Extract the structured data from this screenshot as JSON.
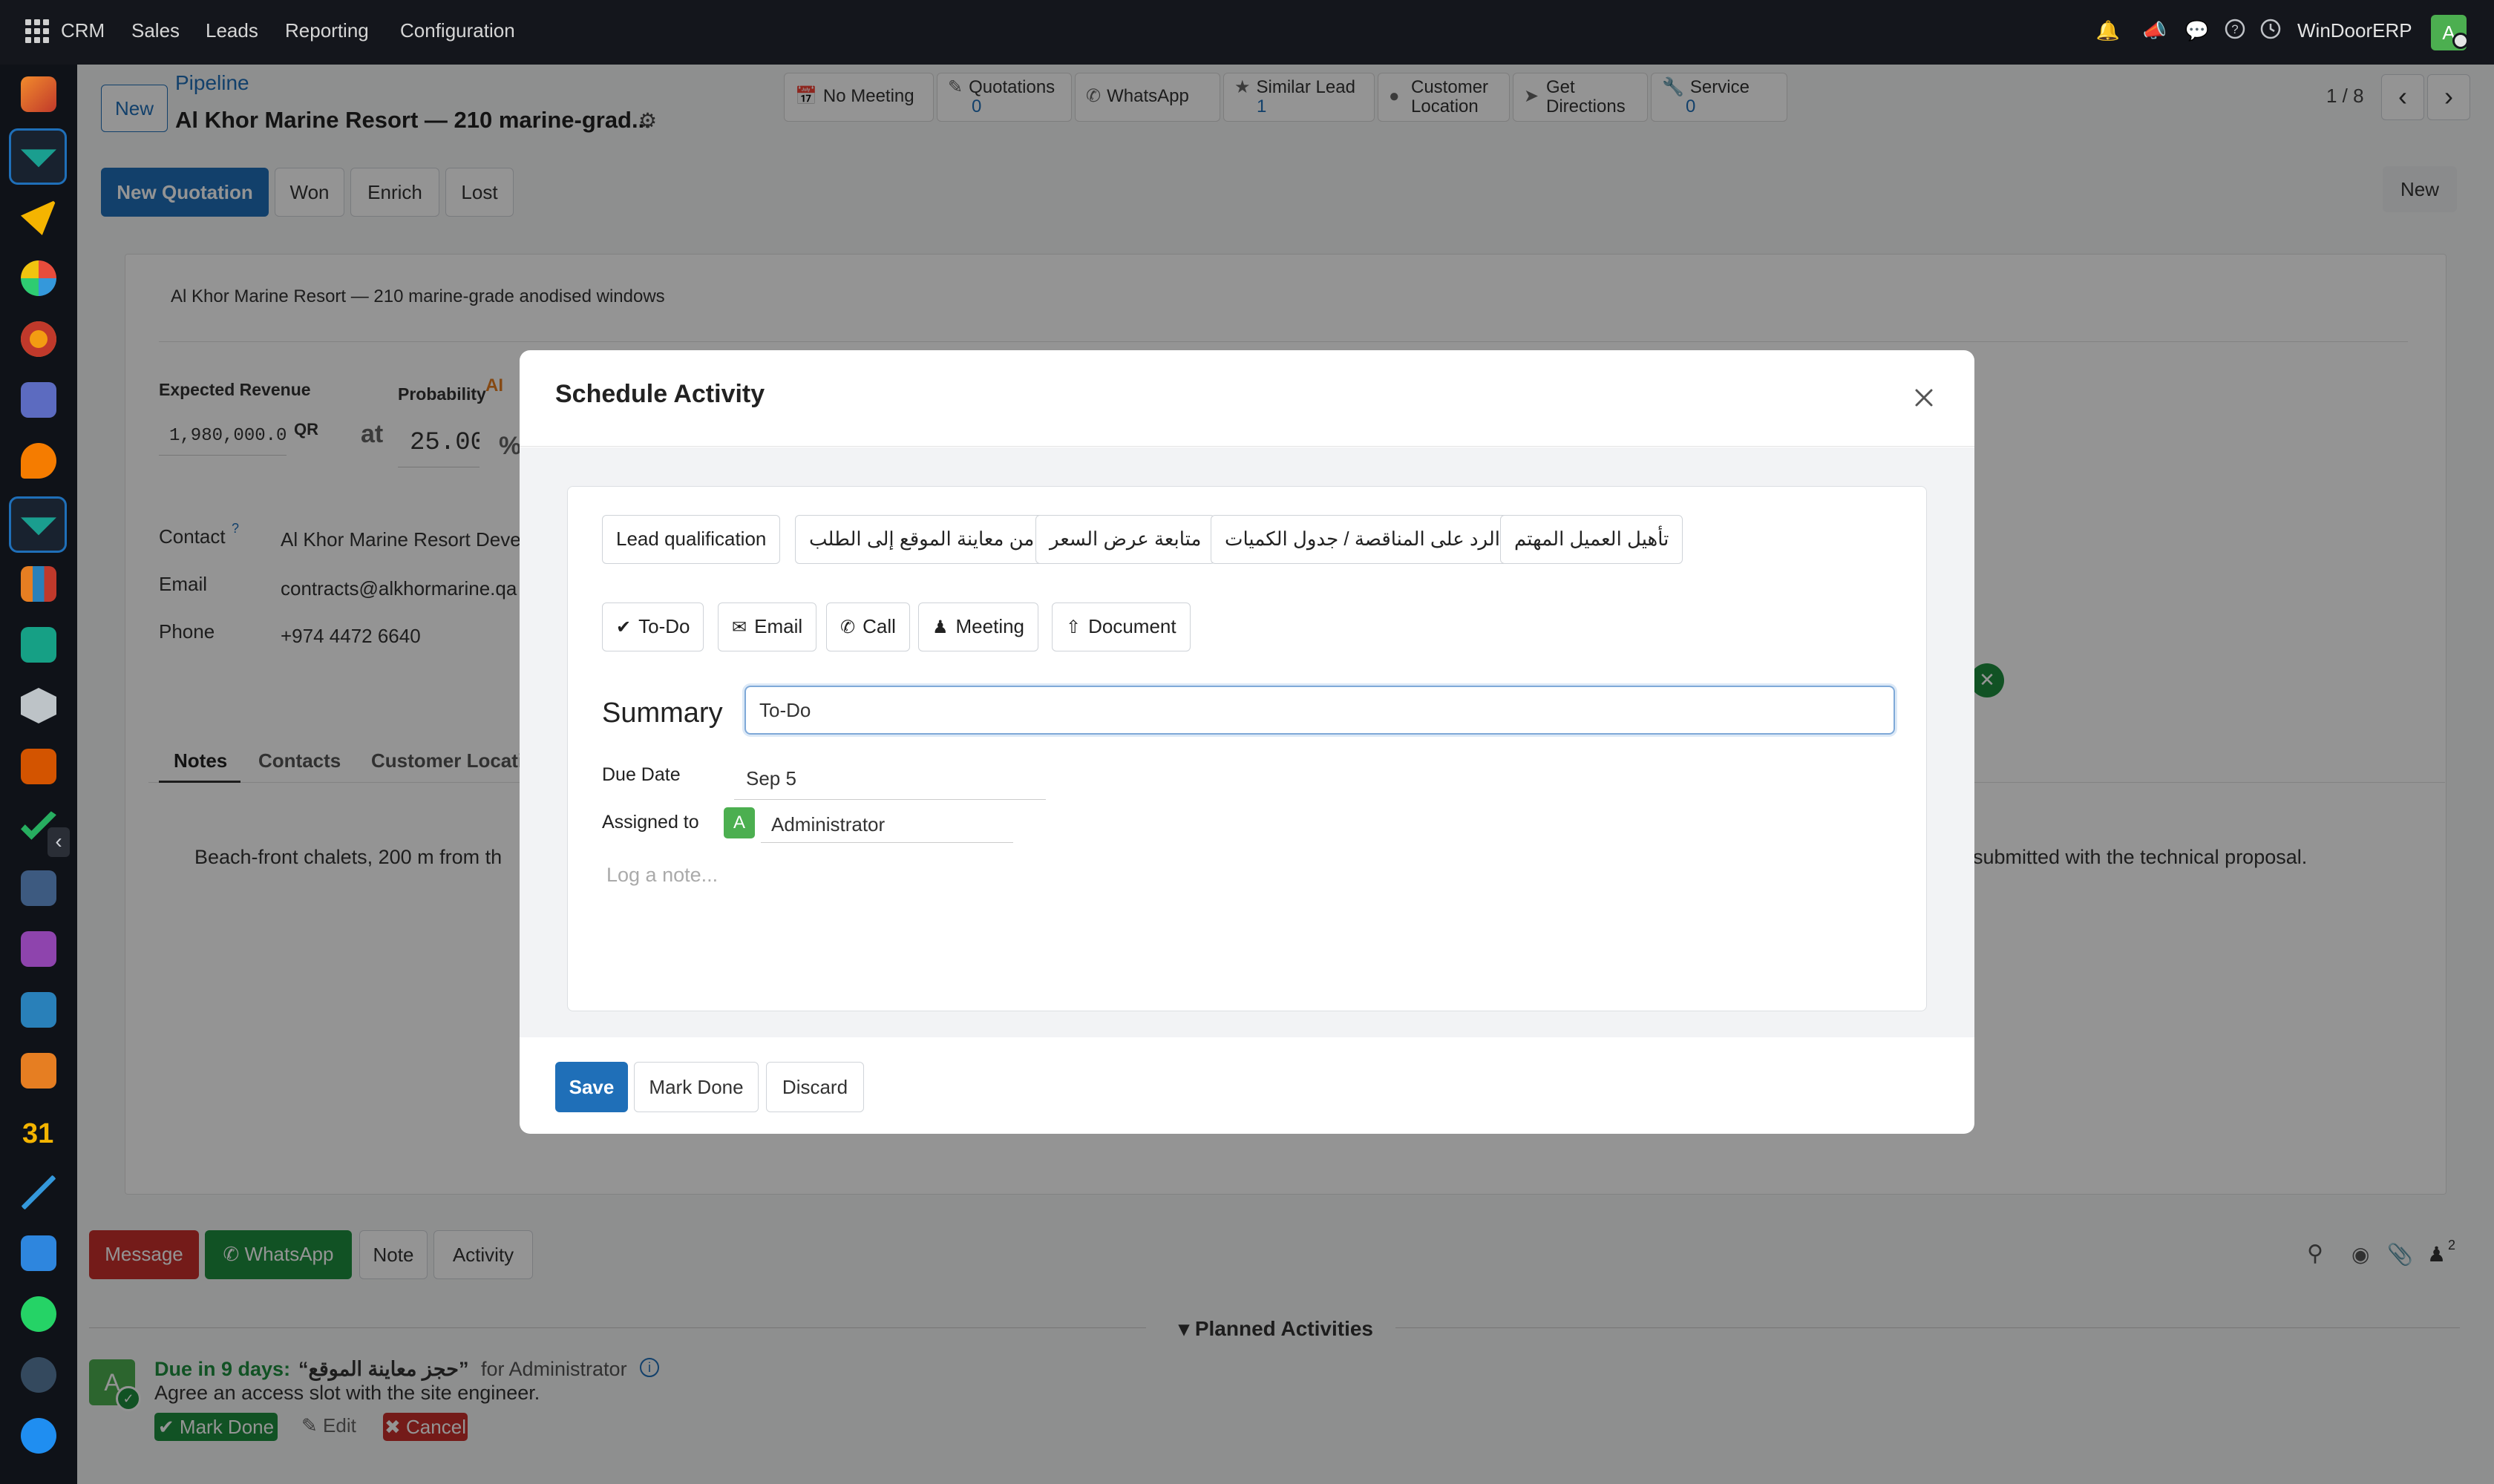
{
  "topnav": {
    "menu": [
      "CRM",
      "Sales",
      "Leads",
      "Reporting",
      "Configuration"
    ],
    "company": "WinDoorERP",
    "user_initial": "A"
  },
  "breadcrumb": {
    "new_label": "New",
    "parent": "Pipeline",
    "record_title": "Al Khor Marine Resort — 210 marine-grad..."
  },
  "pager": "1 / 8",
  "smart_buttons": [
    {
      "label": "No Meeting",
      "icon": "calendar-icon",
      "count": ""
    },
    {
      "label": "Quotations",
      "icon": "pencil-square-icon",
      "count": "0"
    },
    {
      "label": "WhatsApp",
      "icon": "whatsapp-icon",
      "count": ""
    },
    {
      "label": "Similar Lead",
      "icon": "star-icon",
      "count": "1"
    },
    {
      "label": "Customer Location",
      "icon": "map-pin-icon",
      "count": ""
    },
    {
      "label": "Get Directions",
      "icon": "location-arrow-icon",
      "count": ""
    },
    {
      "label": "Service",
      "icon": "wrench-icon",
      "count": "0"
    }
  ],
  "actions": {
    "new_quotation": "New Quotation",
    "won": "Won",
    "enrich": "Enrich",
    "lost": "Lost",
    "stage_new": "New"
  },
  "form": {
    "name": "Al Khor Marine Resort — 210 marine-grade anodised windows",
    "expected_revenue_label": "Expected Revenue",
    "expected_revenue": "1,980,000.0",
    "currency": "QR",
    "at": "at",
    "probability_label": "Probability",
    "probability": "25.00",
    "percent": "%",
    "contact_label": "Contact",
    "contact": "Al Khor Marine Resort Deve",
    "email_label": "Email",
    "email": "contracts@alkhormarine.qa",
    "phone_label": "Phone",
    "phone": "+974 4472 6640",
    "tabs": [
      "Notes",
      "Contacts",
      "Customer Locatio"
    ],
    "notes_left": "Beach-front chalets, 200 m from th",
    "notes_right": "submitted with the technical proposal."
  },
  "chatter": {
    "message": "Message",
    "whatsapp": "WhatsApp",
    "note": "Note",
    "activity": "Activity",
    "followers_count": "2",
    "planned_header": "Planned Activities",
    "activity_due": "Due in 9 days:",
    "activity_title": "“حجز معاينة الموقع”",
    "activity_for": "for Administrator",
    "activity_note": "Agree an access slot with the site engineer.",
    "mark_done": "Mark Done",
    "edit": "Edit",
    "cancel": "Cancel",
    "avatar_initial": "A"
  },
  "modal": {
    "title": "Schedule Activity",
    "templates": [
      "Lead qualification",
      "من معاينة الموقع إلى الطلب",
      "متابعة عرض السعر",
      "الرد على المناقصة / جدول الكميات",
      "تأهيل العميل المهتم"
    ],
    "types": [
      {
        "label": "To-Do",
        "icon": "check-icon"
      },
      {
        "label": "Email",
        "icon": "envelope-icon"
      },
      {
        "label": "Call",
        "icon": "phone-icon"
      },
      {
        "label": "Meeting",
        "icon": "users-icon"
      },
      {
        "label": "Document",
        "icon": "upload-icon"
      }
    ],
    "summary_label": "Summary",
    "summary_value": "To-Do",
    "due_date_label": "Due Date",
    "due_date": "Sep 5",
    "assigned_label": "Assigned to",
    "assigned_initial": "A",
    "assigned": "Administrator",
    "note_placeholder": "Log a note...",
    "save": "Save",
    "mark_done": "Mark Done",
    "discard": "Discard"
  },
  "colors": {
    "primary": "#1f6fb8",
    "topbar": "#14161c",
    "sidebar": "#0f1218",
    "danger": "#c9302c",
    "success": "#1e8e3e",
    "avatar_green": "#4caf50"
  }
}
